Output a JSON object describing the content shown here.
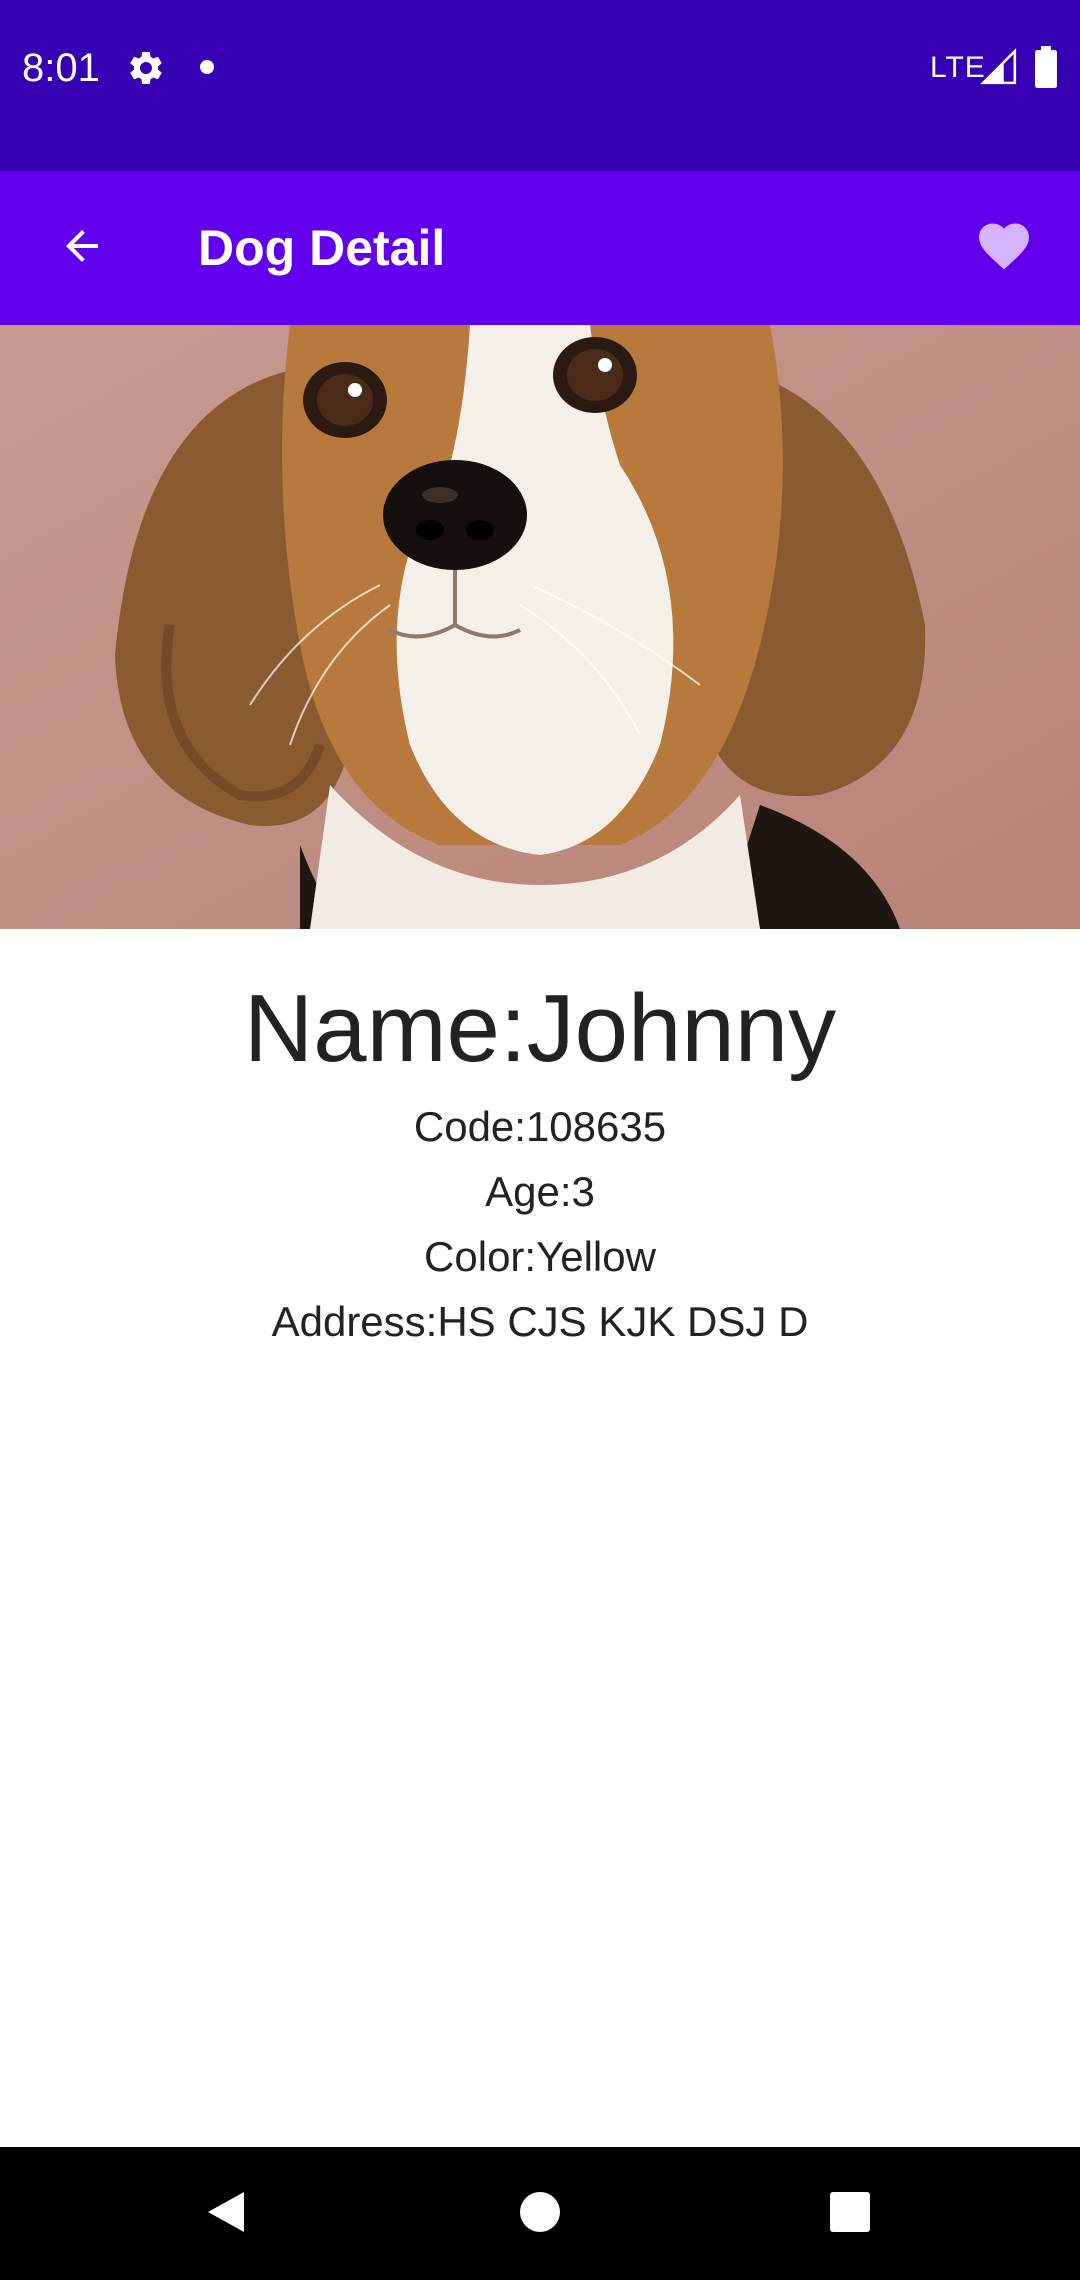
{
  "status_bar": {
    "time": "8:01",
    "network": "LTE",
    "icons": [
      "gear-icon",
      "notification-dot-icon",
      "signal-icon",
      "battery-icon"
    ]
  },
  "app_bar": {
    "title": "Dog Detail",
    "back_icon": "arrow-back-icon",
    "favorite_icon": "heart-icon"
  },
  "photo": {
    "subject": "beagle-photo"
  },
  "dog": {
    "name": "Name:Johnny",
    "code": "Code:108635",
    "age": "Age:3",
    "color": "Color:Yellow",
    "address": "Address:HS CJS KJK DSJ D"
  },
  "nav_bar": {
    "icons": [
      "nav-back-icon",
      "nav-home-icon",
      "nav-recents-icon"
    ]
  },
  "colors": {
    "status_bar": "#3700b3",
    "app_bar": "#6200ee",
    "favorite_heart": "#d7b4ff",
    "text": "#222222",
    "nav_bar": "#000000"
  }
}
